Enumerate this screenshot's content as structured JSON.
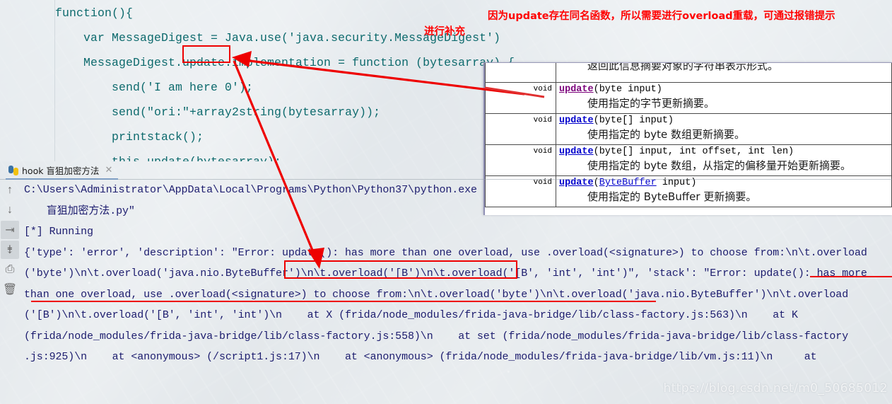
{
  "editor": {
    "code_lines": [
      "function(){",
      "    var MessageDigest = Java.use('java.security.MessageDigest')",
      "    MessageDigest.update.implementation = function (bytesarray) {",
      "        send('I am here 0');",
      "        send(\"ori:\"+array2string(bytesarray));",
      "        printstack();",
      "        this.update(bytesarray);"
    ],
    "highlighted_token": "update."
  },
  "javadoc": {
    "partial_row_text": "返回此信息摘要对象的字符串表示形式。",
    "return_type": "void",
    "methods": [
      {
        "name": "update",
        "params": "(byte  input)",
        "return_type": "void",
        "description": "使用指定的字节更新摘要。",
        "link_state": "visited"
      },
      {
        "name": "update",
        "params": "(byte[]  input)",
        "return_type": "void",
        "description": "使用指定的 byte 数组更新摘要。",
        "link_state": "normal"
      },
      {
        "name": "update",
        "params": "(byte[]  input, int  offset, int  len)",
        "return_type": "void",
        "description": "使用指定的 byte 数组，从指定的偏移量开始更新摘要。",
        "link_state": "normal"
      },
      {
        "name": "update",
        "params_prefix": "(",
        "param_link": "ByteBuffer",
        "params_suffix": "  input)",
        "return_type": "void",
        "description": "使用指定的 ByteBuffer 更新摘要。",
        "link_state": "normal"
      }
    ]
  },
  "console": {
    "tab_label": "hook 盲狙加密方法",
    "tab_icon": "python-icon",
    "close_icon": "close-icon",
    "toolbar_icons": [
      {
        "name": "arrow-up-icon",
        "glyph": "↑",
        "boxed": false
      },
      {
        "name": "arrow-down-icon",
        "glyph": "↓",
        "boxed": false
      },
      {
        "name": "soft-wrap-icon",
        "glyph": "⇥",
        "boxed": true
      },
      {
        "name": "scroll-to-end-icon",
        "glyph": "⇟",
        "boxed": true
      },
      {
        "name": "print-icon",
        "glyph": "⎙",
        "boxed": false
      },
      {
        "name": "clear-all-icon",
        "glyph": "🗑",
        "boxed": false
      }
    ],
    "output_lines": [
      "C:\\Users\\Administrator\\AppData\\Local\\Programs\\Python\\Python37\\python.exe",
      "  盲狙加密方法.py\"",
      "[*] Running",
      "{'type': 'error', 'description': \"Error: update(): has more than one overload, use .overload(<signature>) to choose from:\\n\\t.overload",
      "('byte')\\n\\t.overload('java.nio.ByteBuffer')\\n\\t.overload('[B')\\n\\t.overload('[B', 'int', 'int')\", 'stack': \"Error: update(): has more",
      "than one overload, use .overload(<signature>) to choose from:\\n\\t.overload('byte')\\n\\t.overload('java.nio.ByteBuffer')\\n\\t.overload",
      "('[B')\\n\\t.overload('[B', 'int', 'int')\\n    at X (frida/node_modules/frida-java-bridge/lib/class-factory.js:563)\\n    at K",
      "(frida/node_modules/frida-java-bridge/lib/class-factory.js:558)\\n    at set (frida/node_modules/frida-java-bridge/lib/class-factory",
      ".js:925)\\n    at <anonymous> (/script1.js:17)\\n    at <anonymous> (frida/node_modules/frida-java-bridge/lib/vm.js:11)\\n     at"
    ]
  },
  "annotations": {
    "note_line1": "因为update存在同名函数，所以需要进行overload重载，可通过报错提示",
    "note_line2": "进行补充",
    "note_color": "#ff0000"
  },
  "watermark": {
    "text": "https://blog.csdn.net/m0_50685012"
  }
}
